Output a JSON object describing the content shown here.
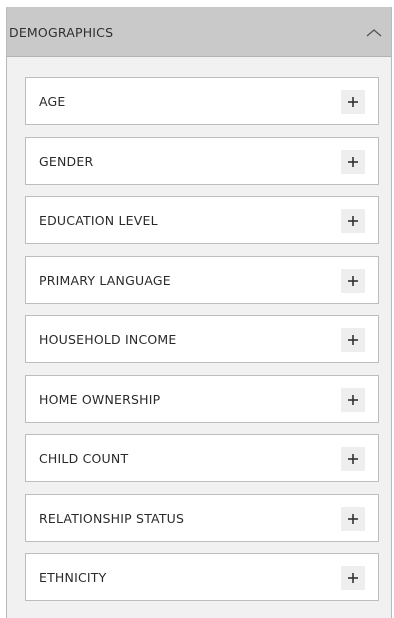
{
  "panel": {
    "title": "DEMOGRAPHICS",
    "toggle_icon": "chevron-up-icon",
    "expanded": true
  },
  "items": [
    {
      "label": "AGE",
      "icon": "plus-icon"
    },
    {
      "label": "GENDER",
      "icon": "plus-icon"
    },
    {
      "label": "EDUCATION LEVEL",
      "icon": "plus-icon"
    },
    {
      "label": "PRIMARY LANGUAGE",
      "icon": "plus-icon"
    },
    {
      "label": "HOUSEHOLD INCOME",
      "icon": "plus-icon"
    },
    {
      "label": "HOME OWNERSHIP",
      "icon": "plus-icon"
    },
    {
      "label": "CHILD COUNT",
      "icon": "plus-icon"
    },
    {
      "label": "RELATIONSHIP STATUS",
      "icon": "plus-icon"
    },
    {
      "label": "ETHNICITY",
      "icon": "plus-icon"
    }
  ],
  "colors": {
    "header_bg": "#c9c9c9",
    "panel_bg": "#f1f1f1",
    "row_bg": "#ffffff",
    "row_border": "#bdbdbd",
    "text": "#2a2a2a"
  }
}
